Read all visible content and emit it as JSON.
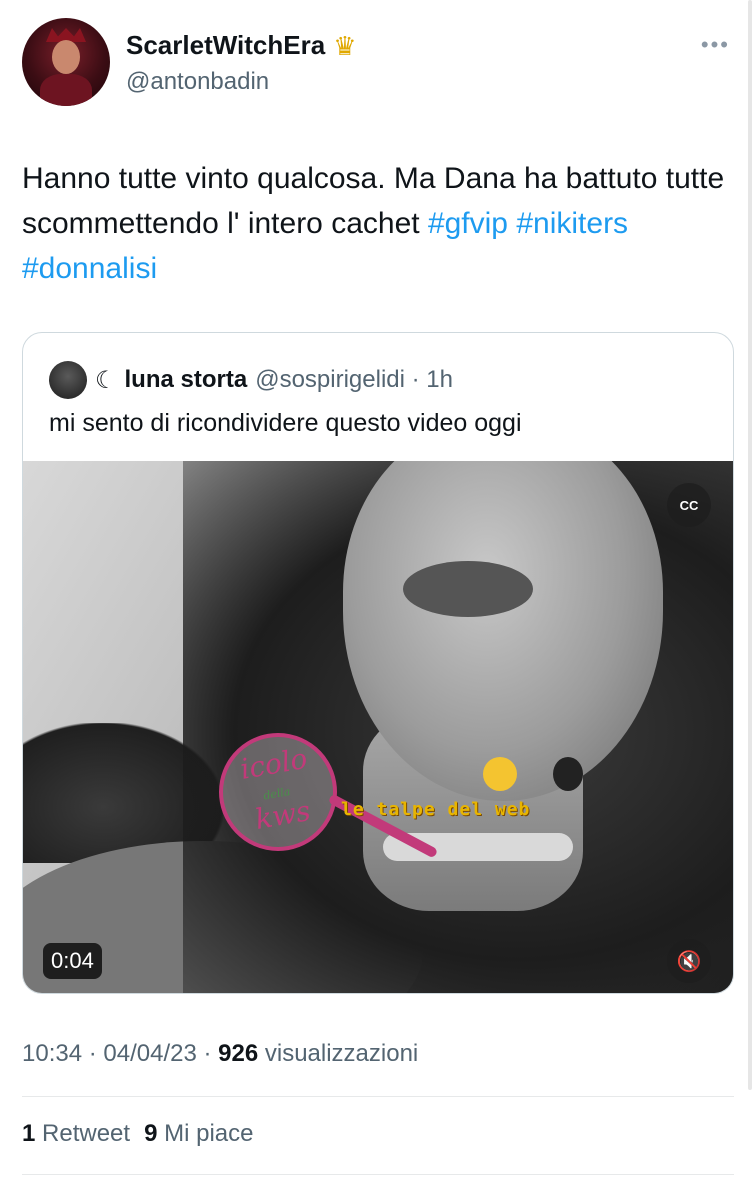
{
  "author": {
    "display_name": "ScarletWitchEra",
    "badge_icon": "crown-icon",
    "handle": "@antonbadin"
  },
  "more_icon": "•••",
  "tweet": {
    "text_before": "Hanno tutte vinto qualcosa. Ma Dana ha battuto tutte scommettendo l' intero cachet ",
    "hashtags": [
      "#gfvip",
      "#nikiters",
      "#donnalisi"
    ]
  },
  "quoted": {
    "moon": "☾",
    "name": "luna storta",
    "handle_time": "@sospirigelidi · 1h",
    "text": "mi sento di ricondividere questo video oggi",
    "video": {
      "duration": "0:04",
      "cc_label": "CC",
      "mute_glyph": "🔇",
      "watermark_1": [
        "icolo",
        "della",
        "kws"
      ],
      "watermark_2": "le talpe del web"
    }
  },
  "meta": {
    "time_date": "10:34 · 04/04/23 · ",
    "views_count": "926",
    "views_label": " visualizzazioni"
  },
  "stats": {
    "retweets_count": "1",
    "retweets_label": "Retweet",
    "likes_count": "9",
    "likes_label": "Mi piace"
  }
}
